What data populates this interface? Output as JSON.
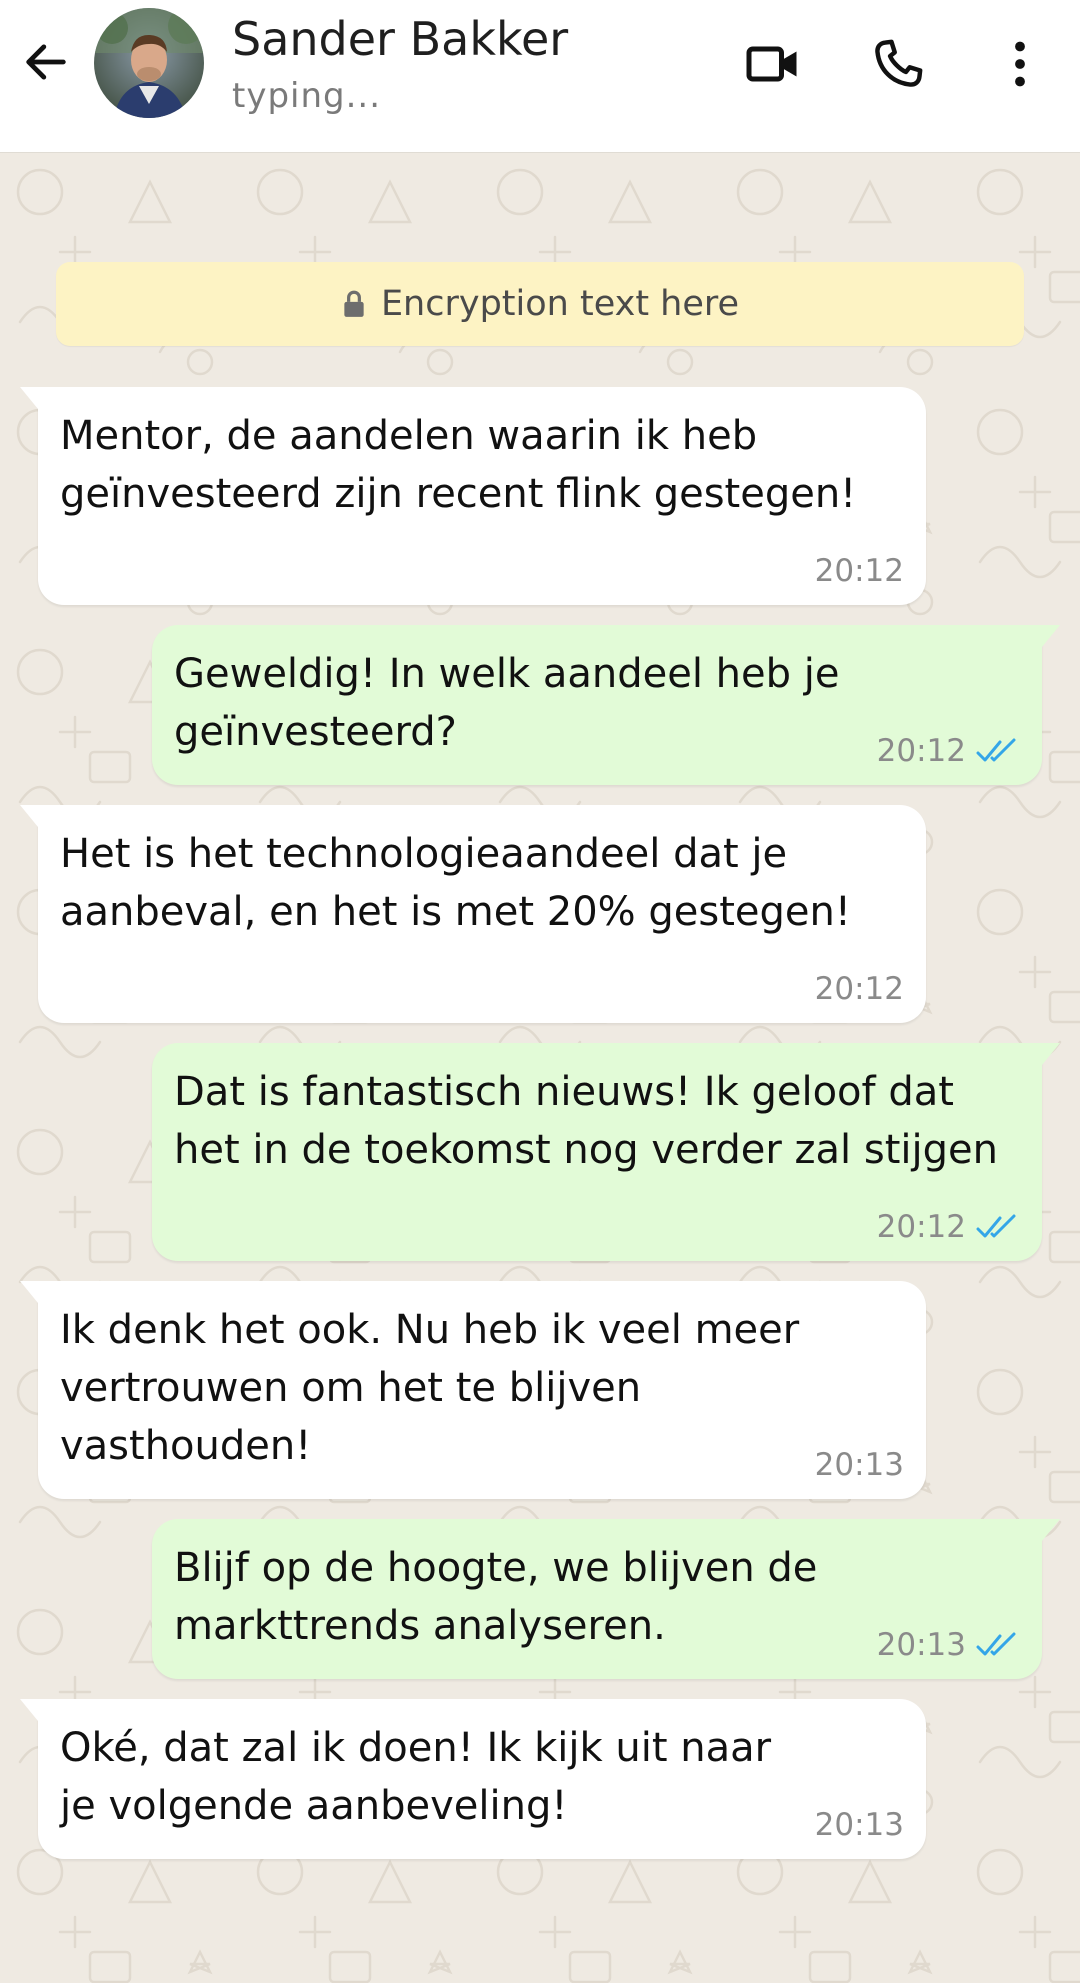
{
  "header": {
    "contact_name": "Sander Bakker",
    "status": "typing..."
  },
  "encryption": {
    "text": "Encryption text here"
  },
  "messages": [
    {
      "direction": "in",
      "text": "Mentor, de aandelen waarin ik heb geïnvesteerd zijn recent flink gestegen!",
      "time": "20:12"
    },
    {
      "direction": "out",
      "text": "Geweldig! In welk aandeel heb je geïnvesteerd?",
      "time": "20:12",
      "status": "read"
    },
    {
      "direction": "in",
      "text": "Het is het technologieaandeel dat je aanbeval, en het is met 20% gestegen!",
      "time": "20:12"
    },
    {
      "direction": "out",
      "text": "Dat is fantastisch nieuws! Ik geloof dat het in de toekomst nog verder zal stijgen",
      "time": "20:12",
      "status": "read"
    },
    {
      "direction": "in",
      "text": "Ik denk het ook. Nu heb ik veel meer vertrouwen om het te blijven vasthouden!",
      "time": "20:13"
    },
    {
      "direction": "out",
      "text": "Blijf op de hoogte, we blijven de markttrends analyseren.",
      "time": "20:13",
      "status": "read"
    },
    {
      "direction": "in",
      "text": "Oké, dat zal ik doen! Ik kijk uit naar je volgende aanbeveling!",
      "time": "20:13"
    }
  ],
  "icons": {
    "back": "arrow-left-icon",
    "video": "video-camera-icon",
    "call": "phone-icon",
    "menu": "more-vertical-icon",
    "lock": "lock-icon",
    "read_receipt": "double-check-icon"
  },
  "colors": {
    "header_bg": "#ffffff",
    "chat_bg": "#efeae2",
    "incoming_bubble": "#ffffff",
    "outgoing_bubble": "#e2fbd7",
    "encryption_bg": "#fdf3c4",
    "read_tick": "#34a6e8"
  }
}
